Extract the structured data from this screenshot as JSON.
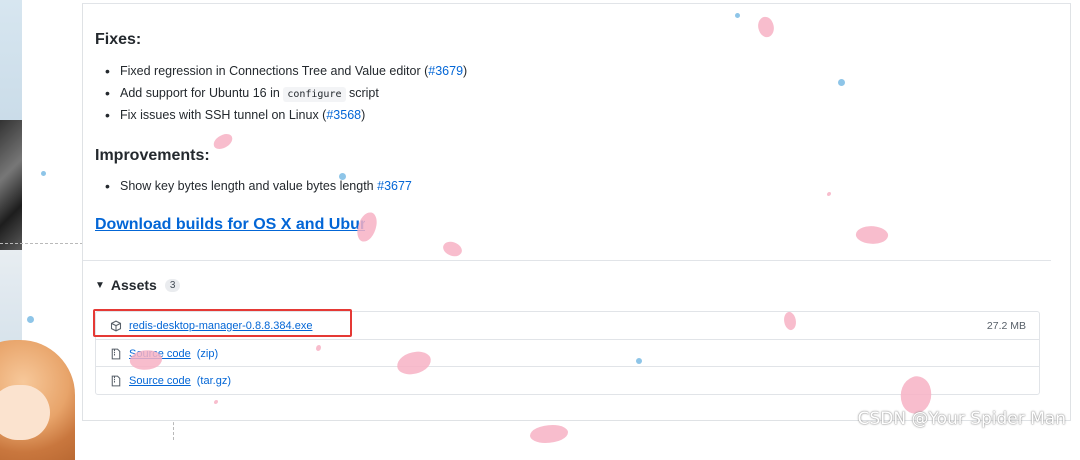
{
  "release_notes": {
    "fixes_heading": "Fixes:",
    "fixes": [
      {
        "text": "Fixed regression in Connections Tree and Value editor (",
        "link": "#3679",
        "tail": ")"
      },
      {
        "text": "Add support for Ubuntu 16 in ",
        "code": "configure",
        "tail": " script"
      },
      {
        "text": "Fix issues with SSH tunnel on Linux (",
        "link": "#3568",
        "tail": ")"
      }
    ],
    "improvements_heading": "Improvements:",
    "improvements": [
      {
        "text": "Show key bytes length and value bytes length ",
        "link": "#3677"
      }
    ],
    "download_heading": "Download builds for OS X and Ubuntu"
  },
  "assets": {
    "label": "Assets",
    "count": "3",
    "items": [
      {
        "name": "redis-desktop-manager-0.8.8.384.exe",
        "sub": "",
        "size": "27.2 MB",
        "icon": "package-icon"
      },
      {
        "name": "Source code",
        "sub": "(zip)",
        "size": "",
        "icon": "file-zip-icon"
      },
      {
        "name": "Source code",
        "sub": "(tar.gz)",
        "size": "",
        "icon": "file-zip-icon"
      }
    ]
  },
  "watermark": "CSDN @Your Spider Man",
  "colors": {
    "link": "#0366d6",
    "highlight": "#e53935",
    "petal": "#f7b2c4"
  }
}
